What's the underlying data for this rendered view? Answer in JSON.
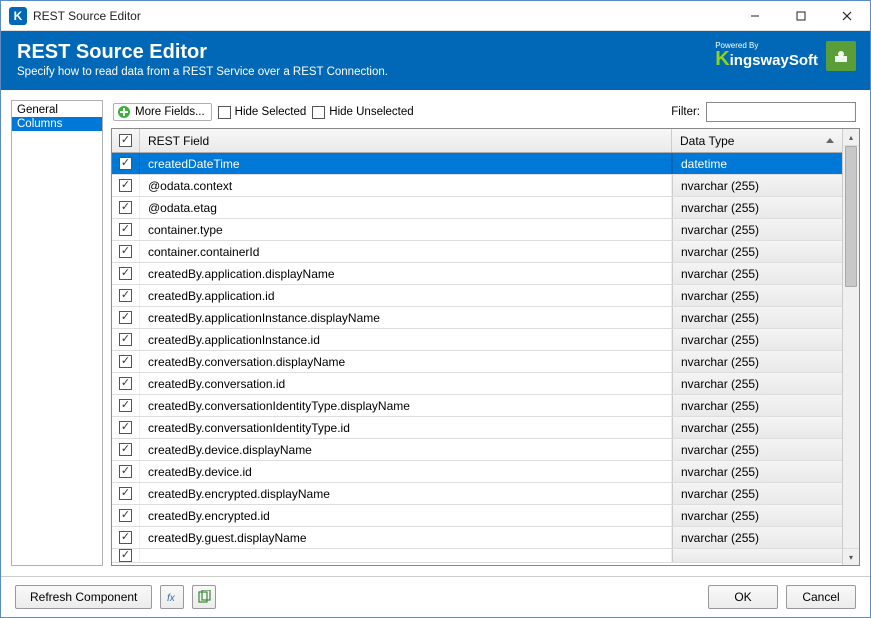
{
  "window": {
    "title": "REST Source Editor"
  },
  "header": {
    "title": "REST Source Editor",
    "subtitle": "Specify how to read data from a REST Service over a REST Connection.",
    "poweredBy": "Powered By",
    "brand": "KingswaySoft"
  },
  "sidebar": {
    "items": [
      {
        "label": "General",
        "selected": false
      },
      {
        "label": "Columns",
        "selected": true
      }
    ]
  },
  "toolbar": {
    "moreFields": "More Fields...",
    "hideSelected": "Hide Selected",
    "hideUnselected": "Hide Unselected",
    "filterLabel": "Filter:",
    "filterValue": ""
  },
  "grid": {
    "headers": {
      "field": "REST Field",
      "dataType": "Data Type"
    },
    "headerChecked": true,
    "rows": [
      {
        "checked": true,
        "field": "createdDateTime",
        "type": "datetime",
        "selected": true
      },
      {
        "checked": true,
        "field": "@odata.context",
        "type": "nvarchar (255)"
      },
      {
        "checked": true,
        "field": "@odata.etag",
        "type": "nvarchar (255)"
      },
      {
        "checked": true,
        "field": "container.type",
        "type": "nvarchar (255)"
      },
      {
        "checked": true,
        "field": "container.containerId",
        "type": "nvarchar (255)"
      },
      {
        "checked": true,
        "field": "createdBy.application.displayName",
        "type": "nvarchar (255)"
      },
      {
        "checked": true,
        "field": "createdBy.application.id",
        "type": "nvarchar (255)"
      },
      {
        "checked": true,
        "field": "createdBy.applicationInstance.displayName",
        "type": "nvarchar (255)"
      },
      {
        "checked": true,
        "field": "createdBy.applicationInstance.id",
        "type": "nvarchar (255)"
      },
      {
        "checked": true,
        "field": "createdBy.conversation.displayName",
        "type": "nvarchar (255)"
      },
      {
        "checked": true,
        "field": "createdBy.conversation.id",
        "type": "nvarchar (255)"
      },
      {
        "checked": true,
        "field": "createdBy.conversationIdentityType.displayName",
        "type": "nvarchar (255)"
      },
      {
        "checked": true,
        "field": "createdBy.conversationIdentityType.id",
        "type": "nvarchar (255)"
      },
      {
        "checked": true,
        "field": "createdBy.device.displayName",
        "type": "nvarchar (255)"
      },
      {
        "checked": true,
        "field": "createdBy.device.id",
        "type": "nvarchar (255)"
      },
      {
        "checked": true,
        "field": "createdBy.encrypted.displayName",
        "type": "nvarchar (255)"
      },
      {
        "checked": true,
        "field": "createdBy.encrypted.id",
        "type": "nvarchar (255)"
      },
      {
        "checked": true,
        "field": "createdBy.guest.displayName",
        "type": "nvarchar (255)"
      }
    ]
  },
  "footer": {
    "refresh": "Refresh Component",
    "ok": "OK",
    "cancel": "Cancel"
  }
}
